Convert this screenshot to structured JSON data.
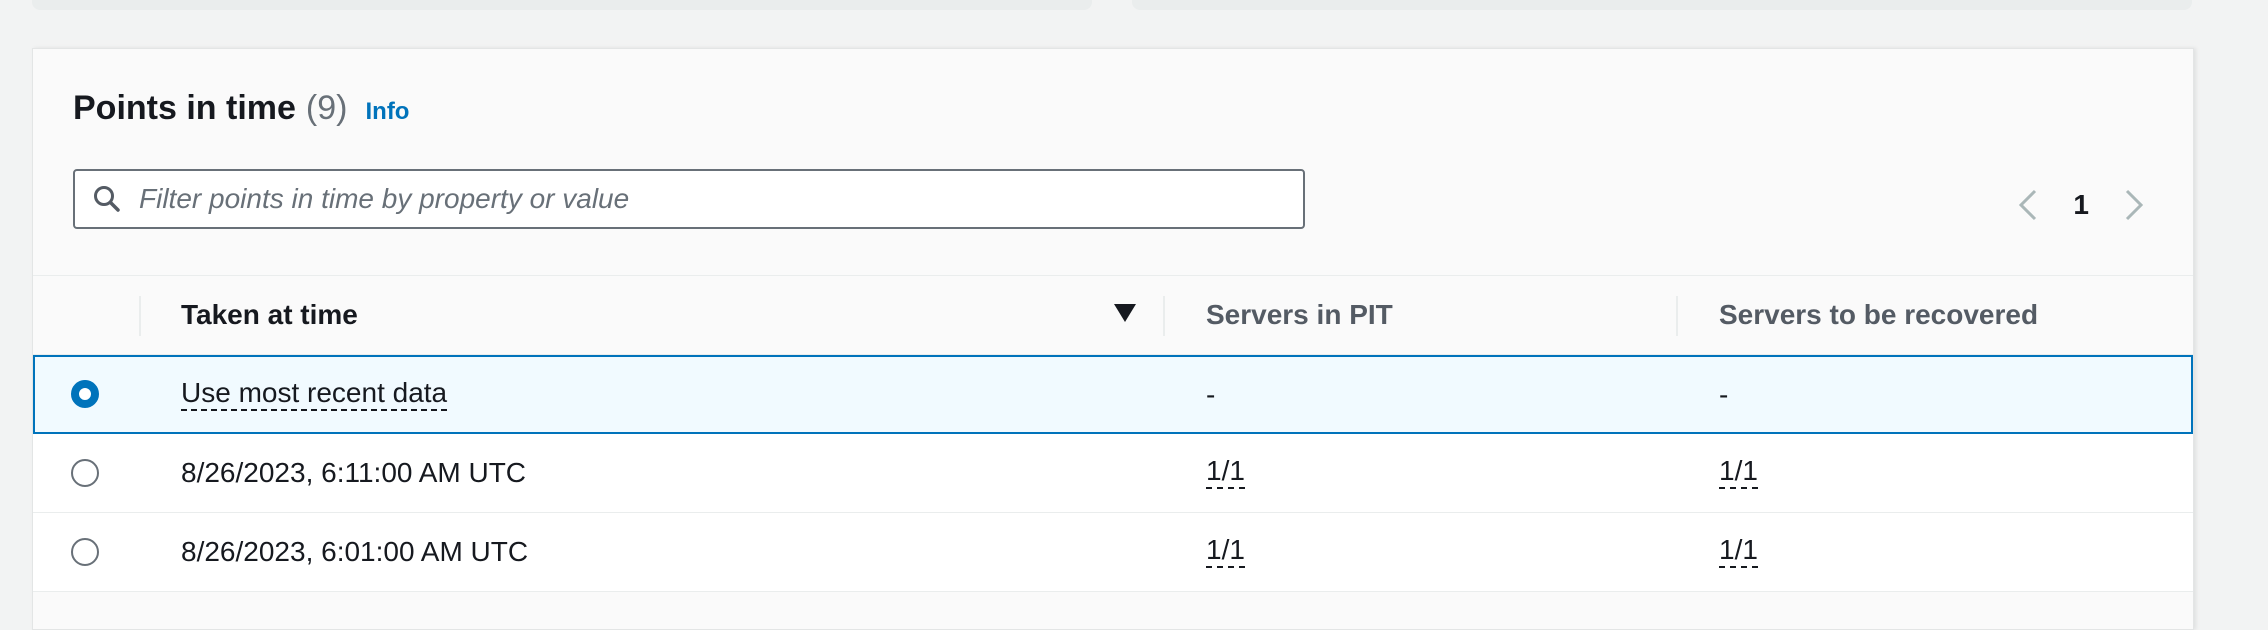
{
  "panel": {
    "title": "Points in time",
    "count": "(9)",
    "info_label": "Info"
  },
  "filter": {
    "placeholder": "Filter points in time by property or value",
    "value": ""
  },
  "pagination": {
    "current_page": "1"
  },
  "table": {
    "columns": [
      "Taken at time",
      "Servers in PIT",
      "Servers to be recovered"
    ],
    "sort_column": "Taken at time",
    "sort_direction": "descending",
    "rows": [
      {
        "selected": true,
        "taken_at": "Use most recent data",
        "servers_in_pit": "-",
        "servers_to_recover": "-"
      },
      {
        "selected": false,
        "taken_at": "8/26/2023, 6:11:00 AM UTC",
        "servers_in_pit": "1/1",
        "servers_to_recover": "1/1"
      },
      {
        "selected": false,
        "taken_at": "8/26/2023, 6:01:00 AM UTC",
        "servers_in_pit": "1/1",
        "servers_to_recover": "1/1"
      }
    ]
  },
  "colors": {
    "accent": "#0073bb",
    "text": "#16191f",
    "muted": "#687078",
    "selected_bg": "#f1faff"
  },
  "icons": {
    "search": "search-icon",
    "prev": "chevron-left-icon",
    "next": "chevron-right-icon",
    "sort": "caret-down-icon"
  }
}
